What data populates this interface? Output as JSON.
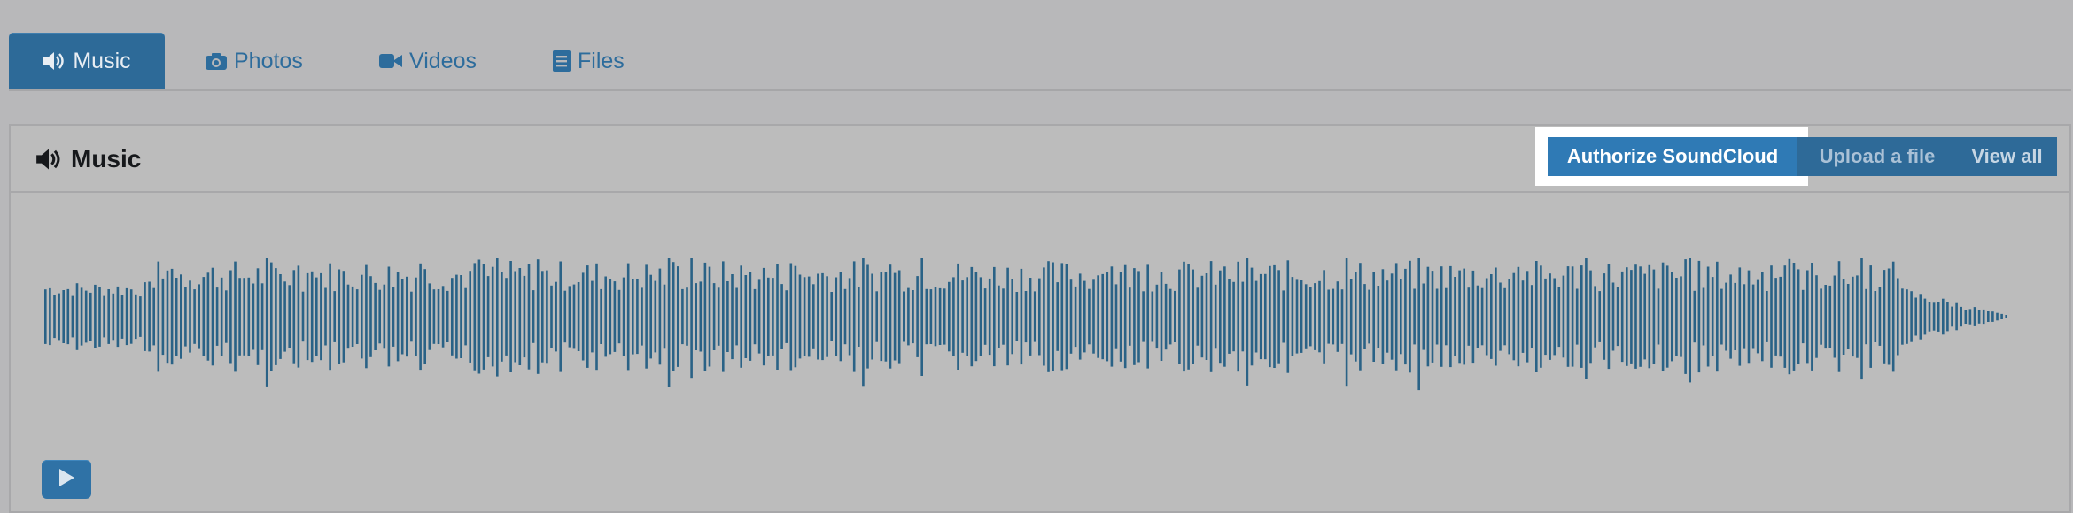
{
  "tabs": [
    {
      "label": "Music",
      "icon": "volume-icon",
      "active": true
    },
    {
      "label": "Photos",
      "icon": "camera-icon",
      "active": false
    },
    {
      "label": "Videos",
      "icon": "video-camera-icon",
      "active": false
    },
    {
      "label": "Files",
      "icon": "file-icon",
      "active": false
    }
  ],
  "panel": {
    "title": "Music",
    "title_icon": "volume-icon",
    "buttons": {
      "authorize": "Authorize SoundCloud",
      "upload": "Upload a file",
      "view_all": "View all"
    },
    "play_icon": "play-icon"
  },
  "colors": {
    "accent": "#2d6a98",
    "button_highlight": "#2f7ab5",
    "waveform": "#2a6286",
    "background": "#b8b8ba"
  }
}
